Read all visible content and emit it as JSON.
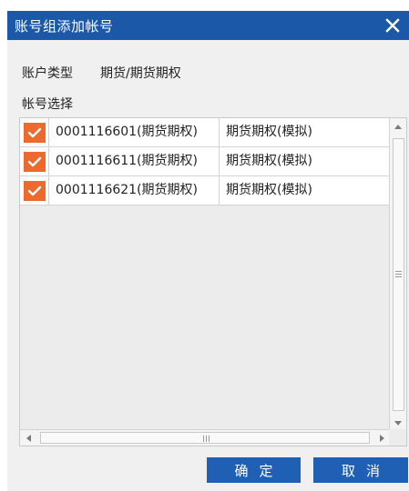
{
  "dialog": {
    "title": "账号组添加帐号",
    "close_icon": "close-icon",
    "colors": {
      "titlebar": "#1c58a8",
      "checkbox": "#ec6a2d",
      "button": "#1f5fb4"
    }
  },
  "form": {
    "account_type_label": "账户类型",
    "account_type_value": "期货/期货期权",
    "account_select_label": "帐号选择"
  },
  "accounts": [
    {
      "checked": true,
      "account": "0001116601(期货期权)",
      "type": "期货期权(模拟)"
    },
    {
      "checked": true,
      "account": "0001116611(期货期权)",
      "type": "期货期权(模拟)"
    },
    {
      "checked": true,
      "account": "0001116621(期货期权)",
      "type": "期货期权(模拟)"
    }
  ],
  "buttons": {
    "ok": "确定",
    "cancel": "取消"
  }
}
